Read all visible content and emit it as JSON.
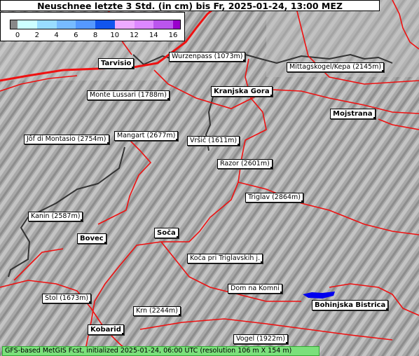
{
  "title": "Neuschnee letzte 3 Std. (in cm) bis Fr, 2025-01-24, 13:00 MEZ",
  "legend": {
    "ticks": [
      "0",
      "2",
      "4",
      "6",
      "8",
      "10",
      "12",
      "14",
      "16"
    ],
    "colors": [
      "#ccffff",
      "#99ddff",
      "#77bbff",
      "#5599ff",
      "#1155ee",
      "#eeaaff",
      "#dd88ff",
      "#bb55ee",
      "#9900cc"
    ]
  },
  "labels": {
    "tarvisio": "Tarvisio",
    "wurzenpass": "Wurzenpass (1073m)",
    "mittagskogel": "Mittagskogel/Kepa (2145m)",
    "monte_lussari": "Monte Lussari (1788m)",
    "kranjska_gora": "Kranjska Gora",
    "mojstrana": "Mojstrana",
    "jof": "Jôf di Montasio (2754m)",
    "mangart": "Mangart (2677m)",
    "vrsic": "Vršič (1611m)",
    "razor": "Razor (2601m)",
    "triglav": "Triglav (2864m)",
    "kanin": "Kanin (2587m)",
    "bovec": "Bovec",
    "soca": "Soča",
    "koca": "Koča pri Triglavskih j.",
    "dom": "Dom na Komni",
    "stol": "Stol (1673m)",
    "krn": "Krn (2244m)",
    "bohinjska": "Bohinjska Bistrica",
    "kobarid": "Kobarid",
    "vogel": "Vogel (1922m)"
  },
  "footer": "GFS-based MetGIS Fcst, initialized 2025-01-24, 06:00 UTC  (resolution 106 m X 154 m)",
  "colors": {
    "roads": "#ee1111",
    "border": "#333333",
    "lake": "#0000ee",
    "terrain": "#a9a9a9",
    "footer_bg": "#7be07b"
  }
}
